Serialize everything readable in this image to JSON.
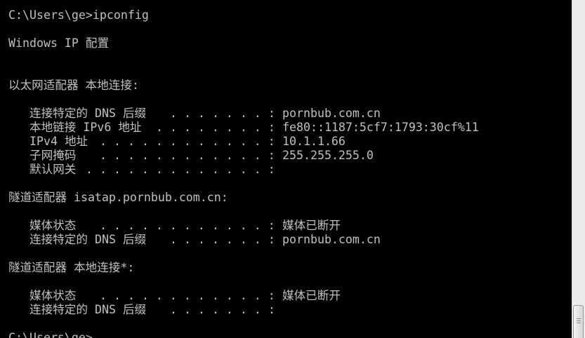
{
  "colors": {
    "background": "#000000",
    "text": "#c0c0c0",
    "scrollbar_track": "#ececec",
    "scrollbar_thumb": "#d6d6d6"
  },
  "console": {
    "command_line": "C:\\Users\\ge>ipconfig",
    "header": "Windows IP 配置",
    "adapters": [
      {
        "title": "以太网适配器 本地连接:",
        "rows": [
          {
            "label": "连接特定的 DNS 后缀",
            "leader": ". . . . . . . :",
            "value": "pornbub.com.cn"
          },
          {
            "label": "本地链接 IPv6 地址",
            "leader": ". . . . . . . . :",
            "value": "fe80::1187:5cf7:1793:30cf%11"
          },
          {
            "label": "IPv4 地址",
            "leader": ". . . . . . . . . . . . :",
            "value": "10.1.1.66"
          },
          {
            "label": "子网掩码",
            "leader": ". . . . . . . . . . . . :",
            "value": "255.255.255.0"
          },
          {
            "label": "默认网关",
            "leader": ". . . . . . . . . . . . . :"
          }
        ]
      },
      {
        "title": "隧道适配器 isatap.pornbub.com.cn:",
        "rows": [
          {
            "label": "媒体状态",
            "leader": ". . . . . . . . . . . . :",
            "value": "媒体已断开"
          },
          {
            "label": "连接特定的 DNS 后缀",
            "leader": ". . . . . . . :",
            "value": "pornbub.com.cn"
          }
        ]
      },
      {
        "title": "隧道适配器 本地连接*:",
        "rows": [
          {
            "label": "媒体状态",
            "leader": ". . . . . . . . . . . . :",
            "value": "媒体已断开"
          },
          {
            "label": "连接特定的 DNS 后缀",
            "leader": ". . . . . . . :"
          }
        ]
      }
    ],
    "prompt": "C:\\Users\\ge>"
  }
}
